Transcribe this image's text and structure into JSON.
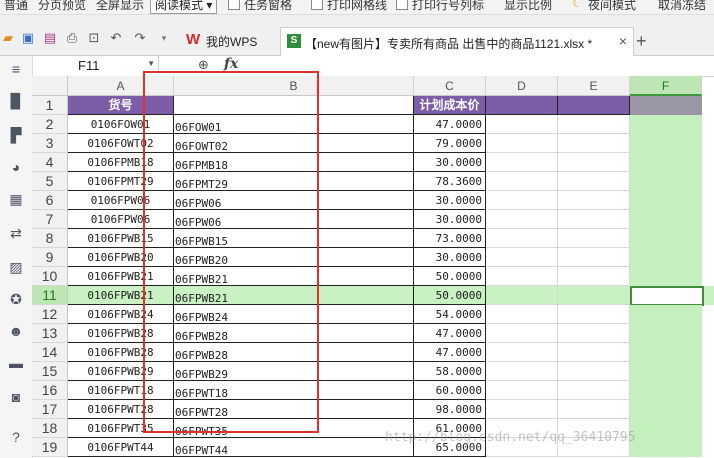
{
  "menu": {
    "items": [
      "普通",
      "分页预览",
      "全屏显示",
      "任务窗格",
      "打印网格线",
      "打印行号列标",
      "显示比例",
      "夜间模式",
      "取消冻结"
    ],
    "reading_mode": "阅读模式"
  },
  "tabs": {
    "wps_label": "我的WPS",
    "file_label": "【new有图片】专卖所有商品 出售中的商品1121.xlsx *"
  },
  "formula": {
    "cell_ref": "F11",
    "fx": "fx"
  },
  "sheet": {
    "columns": [
      "A",
      "B",
      "C",
      "D",
      "E",
      "F"
    ],
    "selected_column": "F",
    "selected_row": 11,
    "header_row": {
      "row": 1,
      "a": "货号",
      "b": "",
      "c": "计划成本价"
    },
    "rows": [
      {
        "row": 2,
        "a": "0106FOW01",
        "b": "06FOW01",
        "c": "47.0000"
      },
      {
        "row": 3,
        "a": "0106FOWT02",
        "b": "06FOWT02",
        "c": "79.0000"
      },
      {
        "row": 4,
        "a": "0106FPMB18",
        "b": "06FPMB18",
        "c": "30.0000"
      },
      {
        "row": 5,
        "a": "0106FPMT29",
        "b": "06FPMT29",
        "c": "78.3600"
      },
      {
        "row": 6,
        "a": "0106FPW06",
        "b": "06FPW06",
        "c": "30.0000"
      },
      {
        "row": 7,
        "a": "0106FPW06",
        "b": "06FPW06",
        "c": "30.0000"
      },
      {
        "row": 8,
        "a": "0106FPWB15",
        "b": "06FPWB15",
        "c": "73.0000"
      },
      {
        "row": 9,
        "a": "0106FPWB20",
        "b": "06FPWB20",
        "c": "30.0000"
      },
      {
        "row": 10,
        "a": "0106FPWB21",
        "b": "06FPWB21",
        "c": "50.0000"
      },
      {
        "row": 11,
        "a": "0106FPWB21",
        "b": "06FPWB21",
        "c": "50.0000"
      },
      {
        "row": 12,
        "a": "0106FPWB24",
        "b": "06FPWB24",
        "c": "54.0000"
      },
      {
        "row": 13,
        "a": "0106FPWB28",
        "b": "06FPWB28",
        "c": "47.0000"
      },
      {
        "row": 14,
        "a": "0106FPWB28",
        "b": "06FPWB28",
        "c": "47.0000"
      },
      {
        "row": 15,
        "a": "0106FPWB29",
        "b": "06FPWB29",
        "c": "58.0000"
      },
      {
        "row": 16,
        "a": "0106FPWT18",
        "b": "06FPWT18",
        "c": "60.0000"
      },
      {
        "row": 17,
        "a": "0106FPWT28",
        "b": "06FPWT28",
        "c": "98.0000"
      },
      {
        "row": 18,
        "a": "0106FPWT35",
        "b": "06FPWT35",
        "c": "61.0000"
      },
      {
        "row": 19,
        "a": "0106FPWT44",
        "b": "06FPWT44",
        "c": "65.0000"
      }
    ]
  },
  "watermark": "http://blog.csdn.net/qq_36410795",
  "colors": {
    "header_purple": "#7b5ea7",
    "selection_green": "#c4f0bd",
    "highlight_red": "#e0302e"
  }
}
